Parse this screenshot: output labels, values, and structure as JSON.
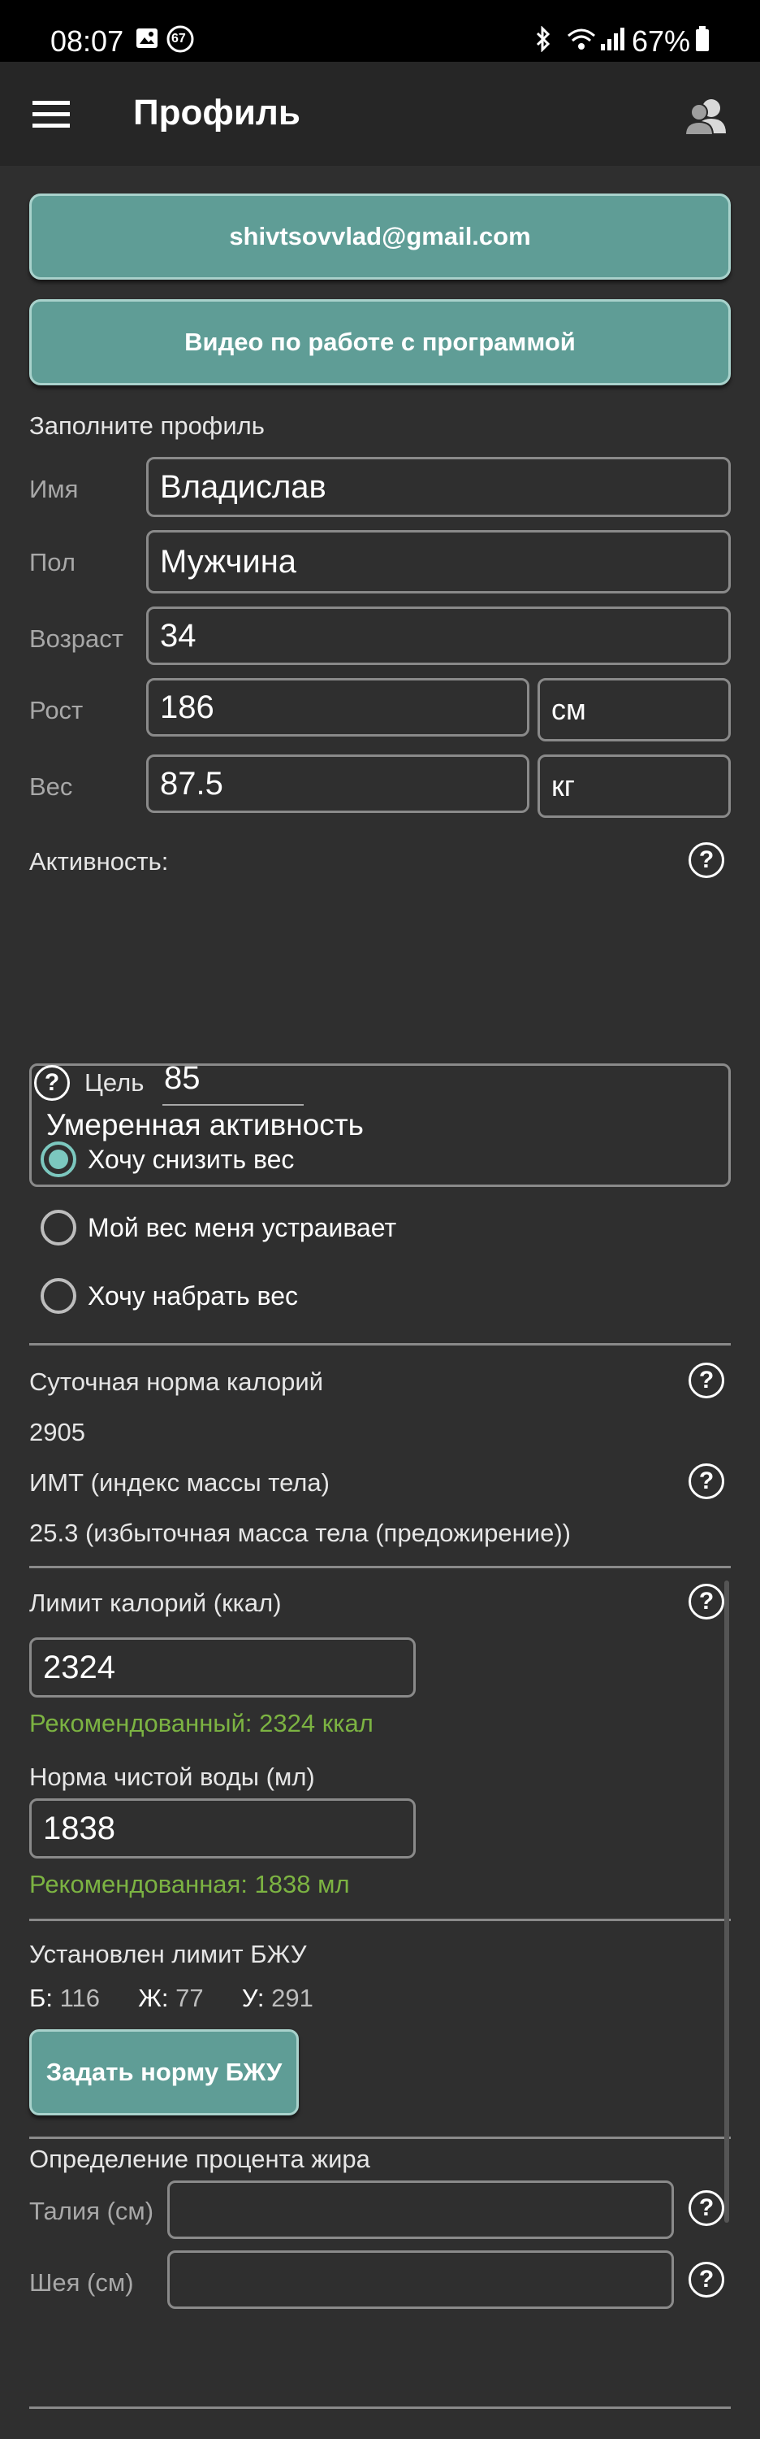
{
  "statusbar": {
    "time": "08:07",
    "notif_badge": "67",
    "battery": "67%"
  },
  "appbar": {
    "title": "Профиль",
    "menu_icon": "menu-icon",
    "account_icon": "users-icon"
  },
  "buttons": {
    "email": "shivtsovvlad@gmail.com",
    "video": "Видео по работе с программой",
    "bzu": "Задать норму БЖУ"
  },
  "profile": {
    "section_title": "Заполните профиль",
    "name_label": "Имя",
    "name_value": "Владислав",
    "gender_label": "Пол",
    "gender_value": "Мужчина",
    "age_label": "Возраст",
    "age_value": "34",
    "height_label": "Рост",
    "height_value": "186",
    "height_unit": "см",
    "weight_label": "Вес",
    "weight_value": "87.5",
    "weight_unit": "кг"
  },
  "activity": {
    "label": "Активность:",
    "value": "Умеренная активность"
  },
  "goal": {
    "label": "Цель",
    "value": "85"
  },
  "goal_options": [
    {
      "label": "Хочу снизить вес",
      "checked": true
    },
    {
      "label": "Мой вес меня устраивает",
      "checked": false
    },
    {
      "label": "Хочу набрать вес",
      "checked": false
    }
  ],
  "stats": {
    "daily_label": "Суточная норма калорий",
    "daily_value": "2905",
    "bmi_label": "ИМТ (индекс массы тела)",
    "bmi_value": "25.3 (избыточная масса тела (предожирение))"
  },
  "limits": {
    "cal_label": "Лимит калорий (ккал)",
    "cal_value": "2324",
    "cal_recommended": "Рекомендованный: 2324 ккал",
    "water_label": "Норма чистой воды (мл)",
    "water_value": "1838",
    "water_recommended": "Рекомендованная: 1838 мл"
  },
  "bzu": {
    "title": "Установлен лимит БЖУ",
    "b_label": "Б:",
    "b_value": "116",
    "zh_label": "Ж:",
    "zh_value": "77",
    "u_label": "У:",
    "u_value": "291"
  },
  "fat": {
    "title": "Определение процента жира",
    "waist_label": "Талия (см)",
    "waist_value": "",
    "neck_label": "Шея (см)",
    "neck_value": ""
  },
  "colors": {
    "accent": "#5f9d96",
    "recommended": "#7cb342",
    "radio": "#7cc8bf"
  }
}
